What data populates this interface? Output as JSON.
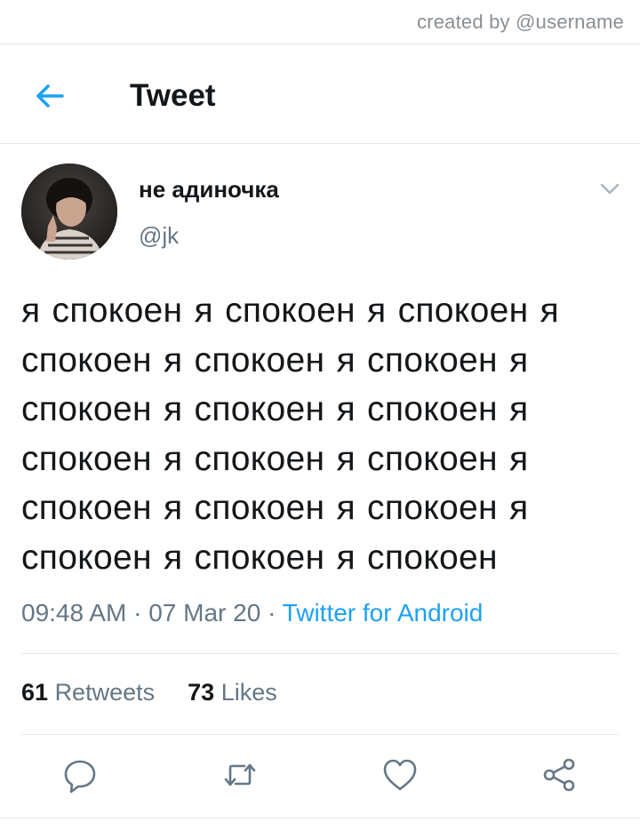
{
  "credit": "created by @username",
  "header": {
    "title": "Tweet",
    "back_icon": "arrow-left-icon",
    "accent": "#1da1f2"
  },
  "author": {
    "display_name": "не адиночка",
    "handle": "@jk",
    "avatar": "profile-photo"
  },
  "tweet": {
    "text": "я спокоен я спокоен я спокоен я спокоен я спокоен я спокоен я спокоен я спокоен я спокоен я спокоен я спокоен я спокоен я спокоен я спокоен я спокоен я спокоен я спокоен я спокоен",
    "time": "09:48 AM",
    "date": "07 Mar 20",
    "separator": "·",
    "source": "Twitter for Android"
  },
  "stats": {
    "retweets_count": "61",
    "retweets_label": "Retweets",
    "likes_count": "73",
    "likes_label": "Likes"
  },
  "actions": [
    "reply-icon",
    "retweet-icon",
    "like-icon",
    "share-icon"
  ],
  "colors": {
    "text": "#14171a",
    "secondary": "#657786",
    "divider": "#e1e8ed",
    "link": "#1da1f2"
  }
}
